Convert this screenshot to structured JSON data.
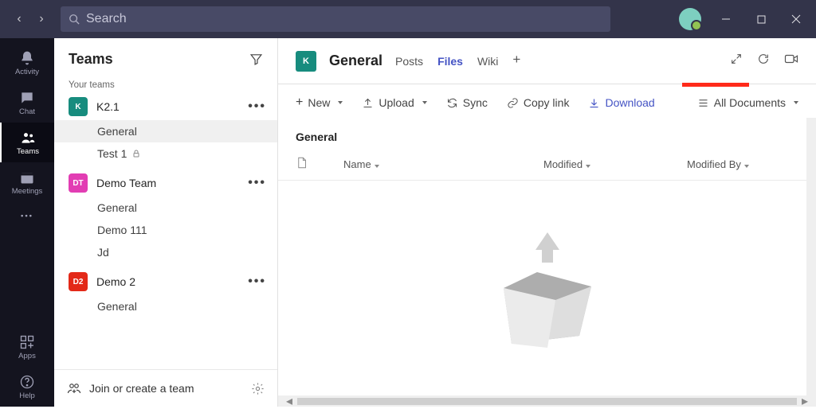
{
  "titlebar": {
    "search_placeholder": "Search"
  },
  "rail": [
    {
      "label": "Activity",
      "icon": "bell"
    },
    {
      "label": "Chat",
      "icon": "chat"
    },
    {
      "label": "Teams",
      "icon": "teams",
      "active": true
    },
    {
      "label": "Meetings",
      "icon": "calendar"
    },
    {
      "label": "",
      "icon": "dots"
    },
    {
      "label": "Apps",
      "icon": "apps",
      "bottom": true
    },
    {
      "label": "Help",
      "icon": "help",
      "bottom": true
    }
  ],
  "teams_pane": {
    "title": "Teams",
    "your_teams_label": "Your teams",
    "join_label": "Join or create a team"
  },
  "teams": [
    {
      "name": "K2.1",
      "initial": "K",
      "color": "#178c7e",
      "channels": [
        {
          "name": "General",
          "active": true
        },
        {
          "name": "Test 1",
          "locked": true
        }
      ]
    },
    {
      "name": "Demo Team",
      "initial": "DT",
      "color": "#e23db3",
      "channels": [
        {
          "name": "General"
        },
        {
          "name": "Demo 111"
        },
        {
          "name": "Jd"
        }
      ]
    },
    {
      "name": "Demo 2",
      "initial": "D2",
      "color": "#e32918",
      "channels": [
        {
          "name": "General"
        }
      ]
    }
  ],
  "channel_header": {
    "badge": "K",
    "title": "General",
    "tabs": [
      {
        "label": "Posts"
      },
      {
        "label": "Files",
        "active": true
      },
      {
        "label": "Wiki"
      }
    ]
  },
  "toolbar": {
    "new": "New",
    "upload": "Upload",
    "sync": "Sync",
    "copylink": "Copy link",
    "download": "Download",
    "alldocs": "All Documents"
  },
  "folder": {
    "name": "General",
    "columns": {
      "name": "Name",
      "modified": "Modified",
      "modified_by": "Modified By"
    }
  }
}
